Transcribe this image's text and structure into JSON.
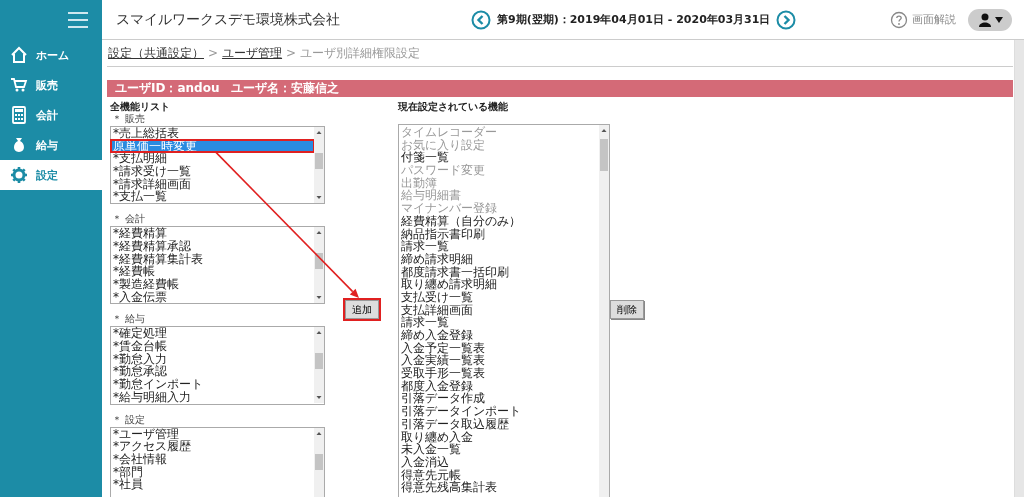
{
  "sidebar": {
    "items": [
      {
        "label": "ホーム",
        "selected": false
      },
      {
        "label": "販売",
        "selected": false
      },
      {
        "label": "会計",
        "selected": false
      },
      {
        "label": "給与",
        "selected": false
      },
      {
        "label": "設定",
        "selected": true
      }
    ]
  },
  "header": {
    "company": "スマイルワークスデモ環境株式会社",
    "period": "第9期(翌期)：2019年04月01日 - 2020年03月31日",
    "help": "画面解説"
  },
  "breadcrumb": [
    {
      "kind": "link",
      "label": "設定（共通設定）"
    },
    {
      "kind": "sep",
      "label": ">"
    },
    {
      "kind": "link",
      "label": "ユーザ管理"
    },
    {
      "kind": "sep",
      "label": ">"
    },
    {
      "kind": "current",
      "label": "ユーザ別詳細権限設定"
    }
  ],
  "user_bar": "ユーザID：andou　ユーザ名：安藤信之",
  "all_functions": {
    "title": "全機能リスト",
    "groups": [
      {
        "label": "＊ 販売",
        "items": [
          {
            "label": "*売上総括表",
            "selected": false,
            "marked": false
          },
          {
            "label": "原単価一時変更",
            "selected": true,
            "marked": true
          },
          {
            "label": "*支払明細",
            "selected": false,
            "marked": false
          },
          {
            "label": "*請求受け一覧",
            "selected": false,
            "marked": false
          },
          {
            "label": "*請求詳細画面",
            "selected": false,
            "marked": false
          },
          {
            "label": "*支払一覧",
            "selected": false,
            "marked": false
          }
        ]
      },
      {
        "label": "＊ 会計",
        "items": [
          {
            "label": "*経費精算",
            "selected": false,
            "marked": false
          },
          {
            "label": "*経費精算承認",
            "selected": false,
            "marked": false
          },
          {
            "label": "*経費精算集計表",
            "selected": false,
            "marked": false
          },
          {
            "label": "*経費帳",
            "selected": false,
            "marked": false
          },
          {
            "label": "*製造経費帳",
            "selected": false,
            "marked": false
          },
          {
            "label": "*入金伝票",
            "selected": false,
            "marked": false
          }
        ]
      },
      {
        "label": "＊ 給与",
        "items": [
          {
            "label": "*確定処理",
            "selected": false,
            "marked": false
          },
          {
            "label": "*賃金台帳",
            "selected": false,
            "marked": false
          },
          {
            "label": "*勤怠入力",
            "selected": false,
            "marked": false
          },
          {
            "label": "*勤怠承認",
            "selected": false,
            "marked": false
          },
          {
            "label": "*勤怠インポート",
            "selected": false,
            "marked": false
          },
          {
            "label": "*給与明細入力",
            "selected": false,
            "marked": false
          }
        ]
      },
      {
        "label": "＊ 設定",
        "items": [
          {
            "label": "*ユーザ管理",
            "selected": false,
            "marked": false
          },
          {
            "label": "*アクセス履歴",
            "selected": false,
            "marked": false
          },
          {
            "label": "*会社情報",
            "selected": false,
            "marked": false
          },
          {
            "label": "*部門",
            "selected": false,
            "marked": false
          },
          {
            "label": "*社員",
            "selected": false,
            "marked": false
          }
        ]
      }
    ]
  },
  "add_button": {
    "label": "追加",
    "marked": true
  },
  "annotation_arrow": true,
  "current_functions": {
    "title": "現在設定されている機能",
    "items": [
      {
        "label": "タイムレコーダー",
        "disabled": true
      },
      {
        "label": "お気に入り設定",
        "disabled": true
      },
      {
        "label": "付箋一覧",
        "disabled": false
      },
      {
        "label": "パスワード変更",
        "disabled": true
      },
      {
        "label": "出勤簿",
        "disabled": true
      },
      {
        "label": "給与明細書",
        "disabled": true
      },
      {
        "label": "マイナンバー登録",
        "disabled": true
      },
      {
        "label": "経費精算（自分のみ）",
        "disabled": false
      },
      {
        "label": "納品指示書印刷",
        "disabled": false
      },
      {
        "label": "請求一覧",
        "disabled": false
      },
      {
        "label": "締め請求明細",
        "disabled": false
      },
      {
        "label": "都度請求書一括印刷",
        "disabled": false
      },
      {
        "label": "取り纏め請求明細",
        "disabled": false
      },
      {
        "label": "支払受け一覧",
        "disabled": false
      },
      {
        "label": "支払詳細画面",
        "disabled": false
      },
      {
        "label": "請求一覧",
        "disabled": false
      },
      {
        "label": "締め入金登録",
        "disabled": false
      },
      {
        "label": "入金予定一覧表",
        "disabled": false
      },
      {
        "label": "入金実績一覧表",
        "disabled": false
      },
      {
        "label": "受取手形一覧表",
        "disabled": false
      },
      {
        "label": "都度入金登録",
        "disabled": false
      },
      {
        "label": "引落データ作成",
        "disabled": false
      },
      {
        "label": "引落データインポート",
        "disabled": false
      },
      {
        "label": "引落データ取込履歴",
        "disabled": false
      },
      {
        "label": "取り纏め入金",
        "disabled": false
      },
      {
        "label": "未入金一覧",
        "disabled": false
      },
      {
        "label": "入金消込",
        "disabled": false
      },
      {
        "label": "得意先元帳",
        "disabled": false
      },
      {
        "label": "得意先残高集計表",
        "disabled": false
      }
    ]
  },
  "delete_button": {
    "label": "削除",
    "marked": false
  }
}
